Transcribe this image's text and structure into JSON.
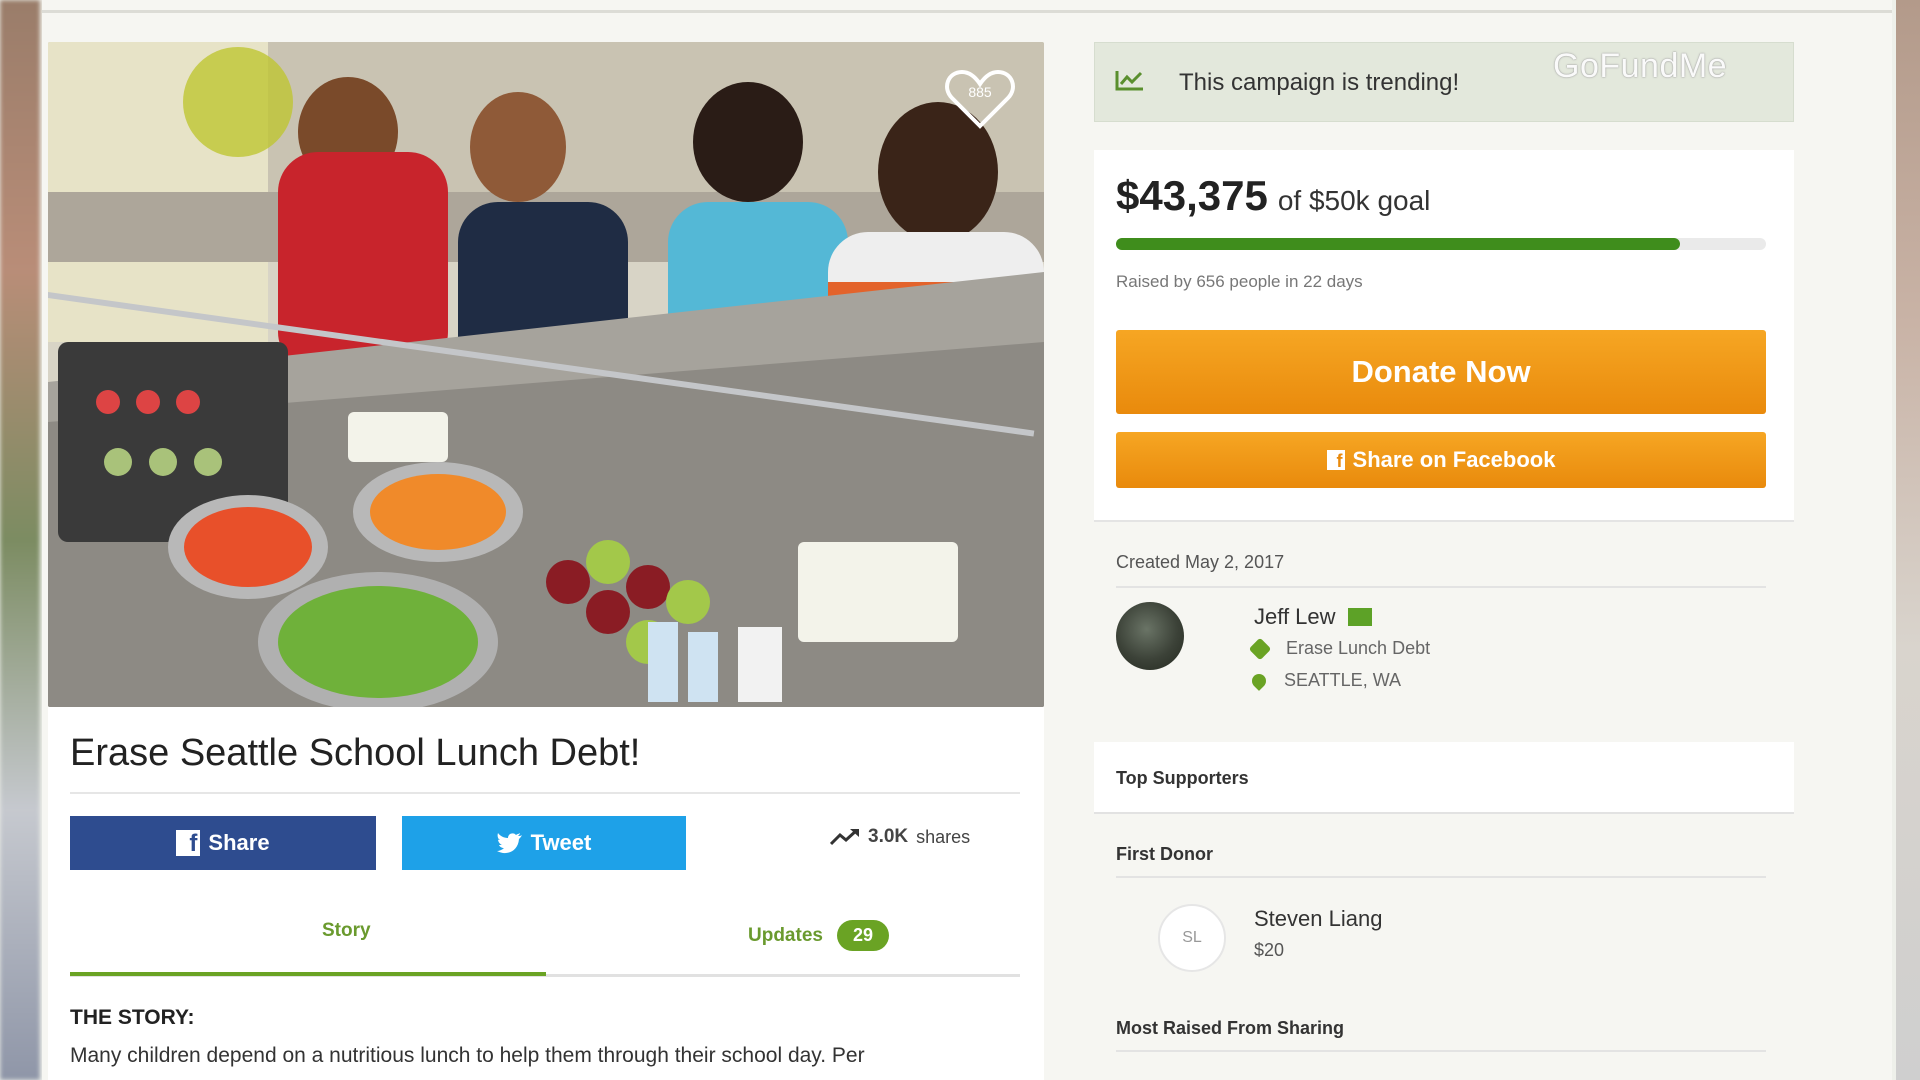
{
  "brand": {
    "watermark": "GoFundMe"
  },
  "hero": {
    "favorites_count": "885"
  },
  "campaign": {
    "title": "Erase Seattle School Lunch Debt!",
    "share_label": "Share",
    "tweet_label": "Tweet",
    "shares_count": "3.0K",
    "shares_suffix": "shares",
    "tabs": [
      {
        "label": "Story",
        "active": true
      },
      {
        "label": "Updates",
        "badge": "29",
        "active": false
      }
    ],
    "story_heading": "THE STORY:",
    "story_text": "Many children depend on a nutritious lunch to help them through their school day. Per"
  },
  "sidebar": {
    "trending_text": "This campaign is trending!",
    "raised_amount": "$43,375",
    "goal_text": "of $50k goal",
    "progress_fraction": 0.8675,
    "raised_by": "Raised by 656 people in 22 days",
    "donate_label": "Donate Now",
    "share_fb_label": "Share on Facebook",
    "created": "Created May 2, 2017",
    "organizer": {
      "name": "Jeff Lew",
      "category": "Erase Lunch Debt",
      "location": "SEATTLE, WA"
    },
    "top_supporters_label": "Top Supporters",
    "first_donor_label": "First Donor",
    "first_donor": {
      "initials": "SL",
      "name": "Steven Liang",
      "amount": "$20"
    },
    "most_raised_label": "Most Raised From Sharing"
  },
  "colors": {
    "accent_green": "#6aa324",
    "progress_green": "#3f8d1c",
    "donate_orange": "#f09a18",
    "facebook_blue": "#2e4c8f",
    "twitter_blue": "#1ea1e8"
  },
  "icons": [
    "heart-icon",
    "trending-icon",
    "facebook-icon",
    "twitter-icon",
    "trending-arrow-icon",
    "mail-icon",
    "tag-icon",
    "location-pin-icon"
  ]
}
